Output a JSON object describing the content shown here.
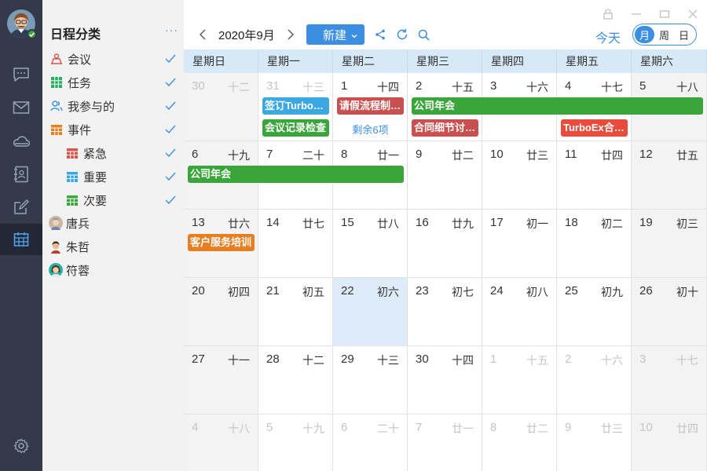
{
  "sidebar": {
    "title": "日程分类",
    "more": "···",
    "categories": [
      {
        "label": "会议",
        "icon": "meeting-icon",
        "color": "#d9534f",
        "checked": true
      },
      {
        "label": "任务",
        "icon": "task-icon",
        "color": "#27ae60",
        "checked": true
      },
      {
        "label": "我参与的",
        "icon": "people-icon",
        "color": "#3c8ee3",
        "checked": true
      },
      {
        "label": "事件",
        "icon": "event-calendar-icon",
        "color": "#e67e22",
        "checked": true
      },
      {
        "label": "紧急",
        "icon": "urgent-calendar-icon",
        "color": "#d9534f",
        "checked": true
      },
      {
        "label": "重要",
        "icon": "important-calendar-icon",
        "color": "#3ba7e3",
        "checked": true
      },
      {
        "label": "次要",
        "icon": "minor-calendar-icon",
        "color": "#3aa53a",
        "checked": true
      }
    ],
    "people": [
      {
        "name": "唐兵",
        "icon": "avatar-tangbing"
      },
      {
        "name": "朱哲",
        "icon": "avatar-zhuzhe"
      },
      {
        "name": "符蓉",
        "icon": "avatar-furong"
      }
    ]
  },
  "toolbar": {
    "month": "2020年9月",
    "new_label": "新建",
    "today_label": "今天",
    "views": [
      "月",
      "周",
      "日"
    ],
    "active_view": "月"
  },
  "calendar": {
    "weekdays": [
      "星期日",
      "星期一",
      "星期二",
      "星期三",
      "星期四",
      "星期五",
      "星期六"
    ],
    "weeks": [
      [
        {
          "d": "30",
          "l": "十二",
          "dim": true
        },
        {
          "d": "31",
          "l": "十三",
          "dim": true
        },
        {
          "d": "1",
          "l": "十四"
        },
        {
          "d": "2",
          "l": "十五"
        },
        {
          "d": "3",
          "l": "十六"
        },
        {
          "d": "4",
          "l": "十七"
        },
        {
          "d": "5",
          "l": "十八"
        }
      ],
      [
        {
          "d": "6",
          "l": "十九"
        },
        {
          "d": "7",
          "l": "二十"
        },
        {
          "d": "8",
          "l": "廿一"
        },
        {
          "d": "9",
          "l": "廿二"
        },
        {
          "d": "10",
          "l": "廿三"
        },
        {
          "d": "11",
          "l": "廿四"
        },
        {
          "d": "12",
          "l": "廿五"
        }
      ],
      [
        {
          "d": "13",
          "l": "廿六"
        },
        {
          "d": "14",
          "l": "廿七"
        },
        {
          "d": "15",
          "l": "廿八"
        },
        {
          "d": "16",
          "l": "廿九"
        },
        {
          "d": "17",
          "l": "初一"
        },
        {
          "d": "18",
          "l": "初二"
        },
        {
          "d": "19",
          "l": "初三"
        }
      ],
      [
        {
          "d": "20",
          "l": "初四"
        },
        {
          "d": "21",
          "l": "初五"
        },
        {
          "d": "22",
          "l": "初六",
          "today": true
        },
        {
          "d": "23",
          "l": "初七"
        },
        {
          "d": "24",
          "l": "初八"
        },
        {
          "d": "25",
          "l": "初九"
        },
        {
          "d": "26",
          "l": "初十"
        }
      ],
      [
        {
          "d": "27",
          "l": "十一"
        },
        {
          "d": "28",
          "l": "十二"
        },
        {
          "d": "29",
          "l": "十三"
        },
        {
          "d": "30",
          "l": "十四"
        },
        {
          "d": "1",
          "l": "十五",
          "dim": true
        },
        {
          "d": "2",
          "l": "十六",
          "dim": true
        },
        {
          "d": "3",
          "l": "十七",
          "dim": true
        }
      ],
      [
        {
          "d": "4",
          "l": "十八",
          "dim": true
        },
        {
          "d": "5",
          "l": "十九",
          "dim": true
        },
        {
          "d": "6",
          "l": "二十",
          "dim": true
        },
        {
          "d": "7",
          "l": "廿一",
          "dim": true
        },
        {
          "d": "8",
          "l": "廿二",
          "dim": true
        },
        {
          "d": "9",
          "l": "廿三",
          "dim": true
        },
        {
          "d": "10",
          "l": "廿四",
          "dim": true
        }
      ]
    ],
    "events": [
      {
        "title": "签订TurboEx合同",
        "week": 0,
        "start": 1,
        "span": 1,
        "row": 0,
        "color": "#3ba7e3"
      },
      {
        "title": "会议记录检查",
        "week": 0,
        "start": 1,
        "span": 1,
        "row": 1,
        "color": "#3aa53a"
      },
      {
        "title": "请假流程制度讨论",
        "week": 0,
        "start": 2,
        "span": 1,
        "row": 0,
        "color": "#c8504f"
      },
      {
        "title": "公司年会",
        "week": 0,
        "start": 3,
        "span": 4,
        "row": 0,
        "color": "#3aa53a"
      },
      {
        "title": "合同细节讨论会",
        "week": 0,
        "start": 3,
        "span": 1,
        "row": 1,
        "color": "#c8504f"
      },
      {
        "title": "TurboEx合同评审",
        "week": 0,
        "start": 5,
        "span": 1,
        "row": 1,
        "color": "#e74c3c"
      },
      {
        "title": "公司年会",
        "week": 1,
        "start": 0,
        "span": 3,
        "row": 0,
        "color": "#3aa53a"
      },
      {
        "title": "客户服务培训",
        "week": 2,
        "start": 0,
        "span": 1,
        "row": 0,
        "color": "#e67e22"
      }
    ],
    "more_items": [
      {
        "text": "剩余6项",
        "week": 0,
        "col": 2,
        "row": 1
      }
    ]
  }
}
